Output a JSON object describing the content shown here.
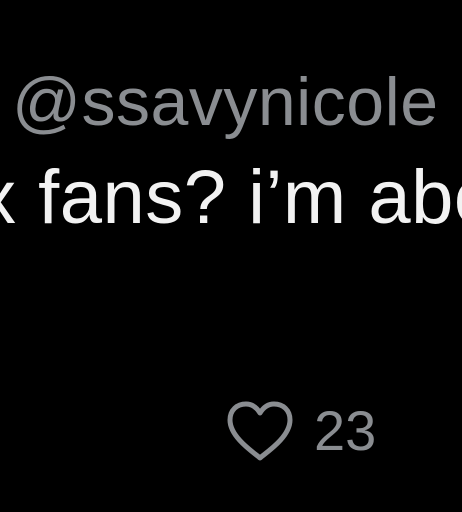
{
  "post": {
    "handle": "@ssavynicole",
    "text_fragment": "x fans? i’m abo"
  },
  "actions": {
    "like": {
      "icon": "heart-outline-icon",
      "count": "23"
    }
  },
  "colors": {
    "background": "#000000",
    "text_primary": "#f2f2f2",
    "text_secondary": "#8a8d91"
  }
}
